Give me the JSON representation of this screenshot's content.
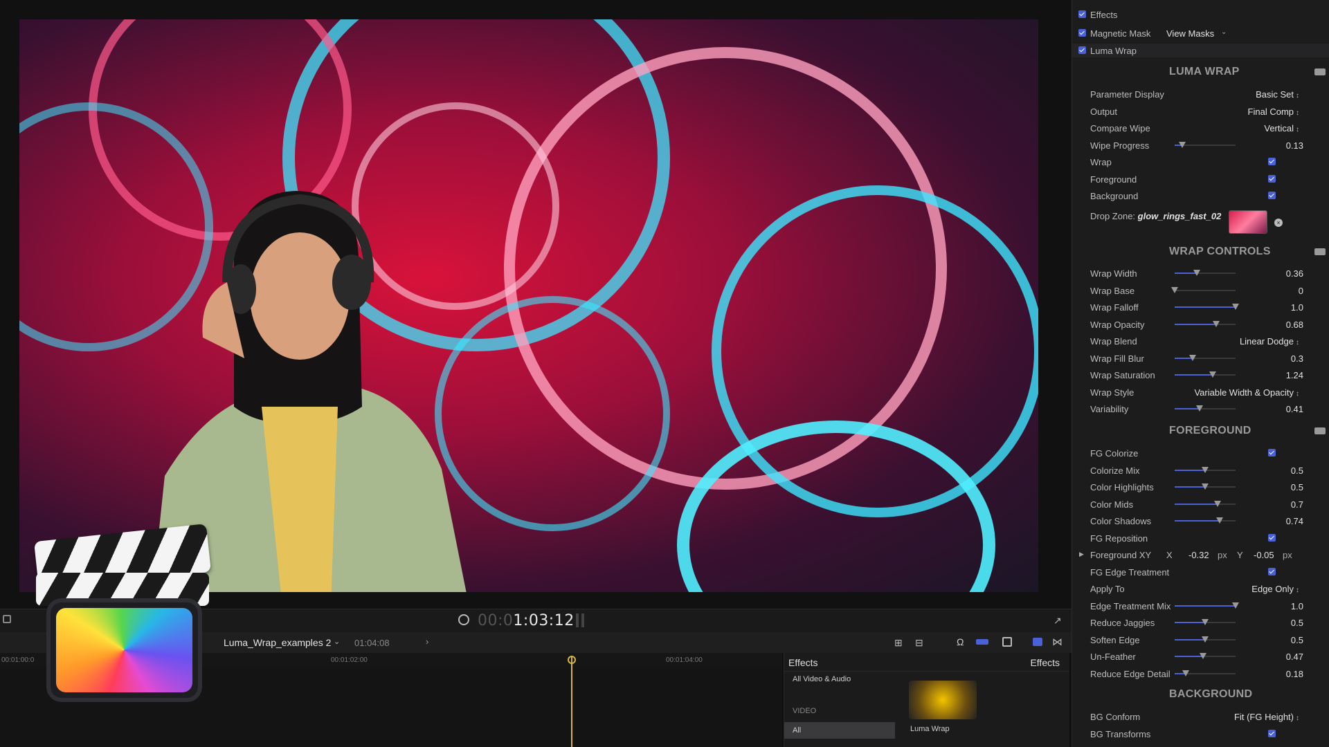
{
  "viewer": {
    "timecode_dim": "00:0",
    "timecode_main": "1:03:12"
  },
  "timeline": {
    "project_name": "Luma_Wrap_examples 2",
    "duration": "01:04:08",
    "ruler": [
      "00:01:00:0",
      "00:01:02:00",
      "00:01:04:00"
    ]
  },
  "effects_browser": {
    "title": "Effects",
    "dropdown": "Effects",
    "categories": [
      "All Video & Audio",
      "VIDEO",
      "All"
    ],
    "thumbnail_label": "Luma Wrap"
  },
  "inspector": {
    "effects_label": "Effects",
    "magnetic_mask_label": "Magnetic Mask",
    "view_masks": "View Masks",
    "luma_wrap_label": "Luma Wrap",
    "sections": {
      "luma_wrap": "LUMA WRAP",
      "wrap_controls": "WRAP CONTROLS",
      "foreground": "FOREGROUND",
      "background": "BACKGROUND"
    },
    "luma": [
      {
        "label": "Parameter Display",
        "value": "Basic Set",
        "kind": "popup"
      },
      {
        "label": "Output",
        "value": "Final Comp",
        "kind": "popup"
      },
      {
        "label": "Compare Wipe",
        "value": "Vertical",
        "kind": "popup"
      },
      {
        "label": "Wipe Progress",
        "value": "0.13",
        "kind": "slider",
        "level": 0.13
      },
      {
        "label": "Wrap",
        "kind": "check"
      },
      {
        "label": "Foreground",
        "kind": "check"
      },
      {
        "label": "Background",
        "kind": "check"
      }
    ],
    "drop_zone_label": "Drop Zone:",
    "drop_zone_value": "glow_rings_fast_02",
    "wrap_controls": [
      {
        "label": "Wrap Width",
        "value": "0.36",
        "kind": "slider",
        "level": 0.36
      },
      {
        "label": "Wrap Base",
        "value": "0",
        "kind": "slider",
        "level": 0.0
      },
      {
        "label": "Wrap Falloff",
        "value": "1.0",
        "kind": "slider",
        "level": 1.0
      },
      {
        "label": "Wrap Opacity",
        "value": "0.68",
        "kind": "slider",
        "level": 0.68
      },
      {
        "label": "Wrap Blend",
        "value": "Linear Dodge",
        "kind": "popup"
      },
      {
        "label": "Wrap Fill Blur",
        "value": "0.3",
        "kind": "slider",
        "level": 0.3
      },
      {
        "label": "Wrap Saturation",
        "value": "1.24",
        "kind": "slider",
        "level": 0.62
      },
      {
        "label": "Wrap Style",
        "value": "Variable Width & Opacity",
        "kind": "popup"
      },
      {
        "label": "Variability",
        "value": "0.41",
        "kind": "slider",
        "level": 0.41
      }
    ],
    "foreground": [
      {
        "label": "FG Colorize",
        "kind": "check"
      },
      {
        "label": "Colorize Mix",
        "value": "0.5",
        "kind": "slider",
        "level": 0.5
      },
      {
        "label": "Color Highlights",
        "value": "0.5",
        "kind": "slider",
        "level": 0.5
      },
      {
        "label": "Color Mids",
        "value": "0.7",
        "kind": "slider",
        "level": 0.7
      },
      {
        "label": "Color Shadows",
        "value": "0.74",
        "kind": "slider",
        "level": 0.74
      },
      {
        "label": "FG Reposition",
        "kind": "check"
      },
      {
        "label": "Foreground XY",
        "kind": "xy",
        "x_label": "X",
        "x": "-0.32",
        "x_unit": "px",
        "y_label": "Y",
        "y": "-0.05",
        "y_unit": "px"
      },
      {
        "label": "FG Edge Treatment",
        "kind": "check"
      },
      {
        "label": "Apply To",
        "value": "Edge Only",
        "kind": "popup"
      },
      {
        "label": "Edge Treatment Mix",
        "value": "1.0",
        "kind": "slider",
        "level": 1.0
      },
      {
        "label": "Reduce Jaggies",
        "value": "0.5",
        "kind": "slider",
        "level": 0.5
      },
      {
        "label": "Soften Edge",
        "value": "0.5",
        "kind": "slider",
        "level": 0.5
      },
      {
        "label": "Un-Feather",
        "value": "0.47",
        "kind": "slider",
        "level": 0.47
      },
      {
        "label": "Reduce Edge Detail",
        "value": "0.18",
        "kind": "slider",
        "level": 0.18
      }
    ],
    "background": [
      {
        "label": "BG Conform",
        "value": "Fit (FG Height)",
        "kind": "popup"
      },
      {
        "label": "BG Transforms",
        "kind": "check"
      }
    ]
  },
  "colors": {
    "accent": "#4a61d8",
    "playhead": "#d7b73a"
  }
}
